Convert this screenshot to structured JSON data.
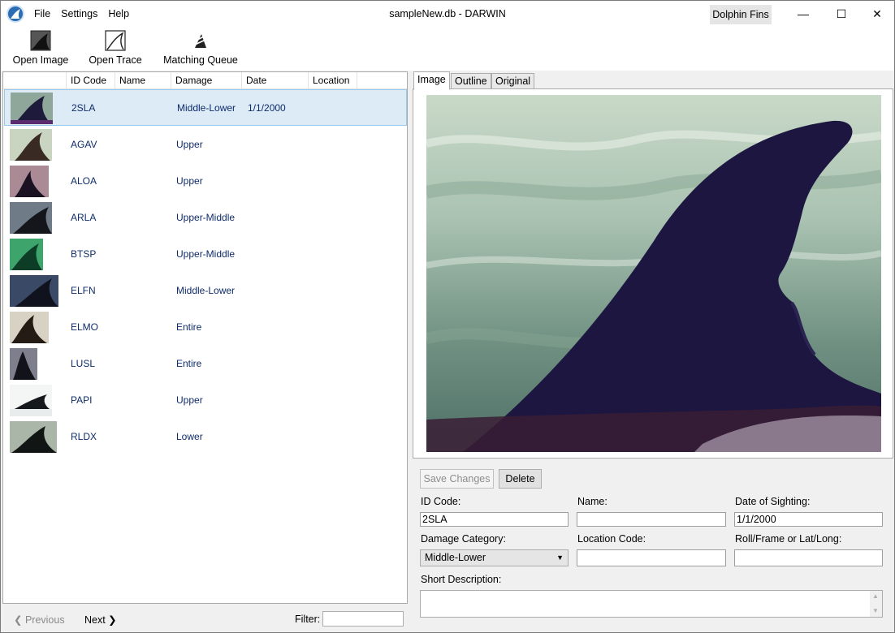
{
  "window": {
    "title": "sampleNew.db - DARWIN",
    "db_button": "Dolphin Fins",
    "menu": [
      "File",
      "Settings",
      "Help"
    ],
    "controls": {
      "minimize": "—",
      "maximize": "☐",
      "close": "✕"
    }
  },
  "toolbar": {
    "open_image": "Open Image",
    "open_trace": "Open Trace",
    "matching_queue": "Matching Queue"
  },
  "list": {
    "columns": [
      "ID Code",
      "Name",
      "Damage",
      "Date",
      "Location"
    ],
    "rows": [
      {
        "id": "2SLA",
        "name": "",
        "damage": "Middle-Lower",
        "date": "1/1/2000",
        "location": "",
        "selected": true
      },
      {
        "id": "AGAV",
        "name": "",
        "damage": "Upper",
        "date": "",
        "location": ""
      },
      {
        "id": "ALOA",
        "name": "",
        "damage": "Upper",
        "date": "",
        "location": ""
      },
      {
        "id": "ARLA",
        "name": "",
        "damage": "Upper-Middle",
        "date": "",
        "location": ""
      },
      {
        "id": "BTSP",
        "name": "",
        "damage": "Upper-Middle",
        "date": "",
        "location": ""
      },
      {
        "id": "ELFN",
        "name": "",
        "damage": "Middle-Lower",
        "date": "",
        "location": ""
      },
      {
        "id": "ELMO",
        "name": "",
        "damage": "Entire",
        "date": "",
        "location": ""
      },
      {
        "id": "LUSL",
        "name": "",
        "damage": "Entire",
        "date": "",
        "location": ""
      },
      {
        "id": "PAPI",
        "name": "",
        "damage": "Upper",
        "date": "",
        "location": ""
      },
      {
        "id": "RLDX",
        "name": "",
        "damage": "Lower",
        "date": "",
        "location": ""
      }
    ],
    "footer": {
      "previous": "Previous",
      "next": "Next",
      "filter_label": "Filter:",
      "filter_value": ""
    }
  },
  "tabs": [
    "Image",
    "Outline",
    "Original Image"
  ],
  "form": {
    "save_changes": "Save Changes",
    "delete": "Delete",
    "id_code_label": "ID Code:",
    "id_code_value": "2SLA",
    "name_label": "Name:",
    "name_value": "",
    "date_label": "Date of Sighting:",
    "date_value": "1/1/2000",
    "damage_label": "Damage Category:",
    "damage_value": "Middle-Lower",
    "location_label": "Location Code:",
    "location_value": "",
    "roll_label": "Roll/Frame or Lat/Long:",
    "roll_value": "",
    "short_desc_label": "Short Description:",
    "short_desc_value": ""
  },
  "colors": {
    "selected_row": "#ddebf7",
    "list_text": "#0f2c6b",
    "app_icon": "#2a6db3"
  }
}
